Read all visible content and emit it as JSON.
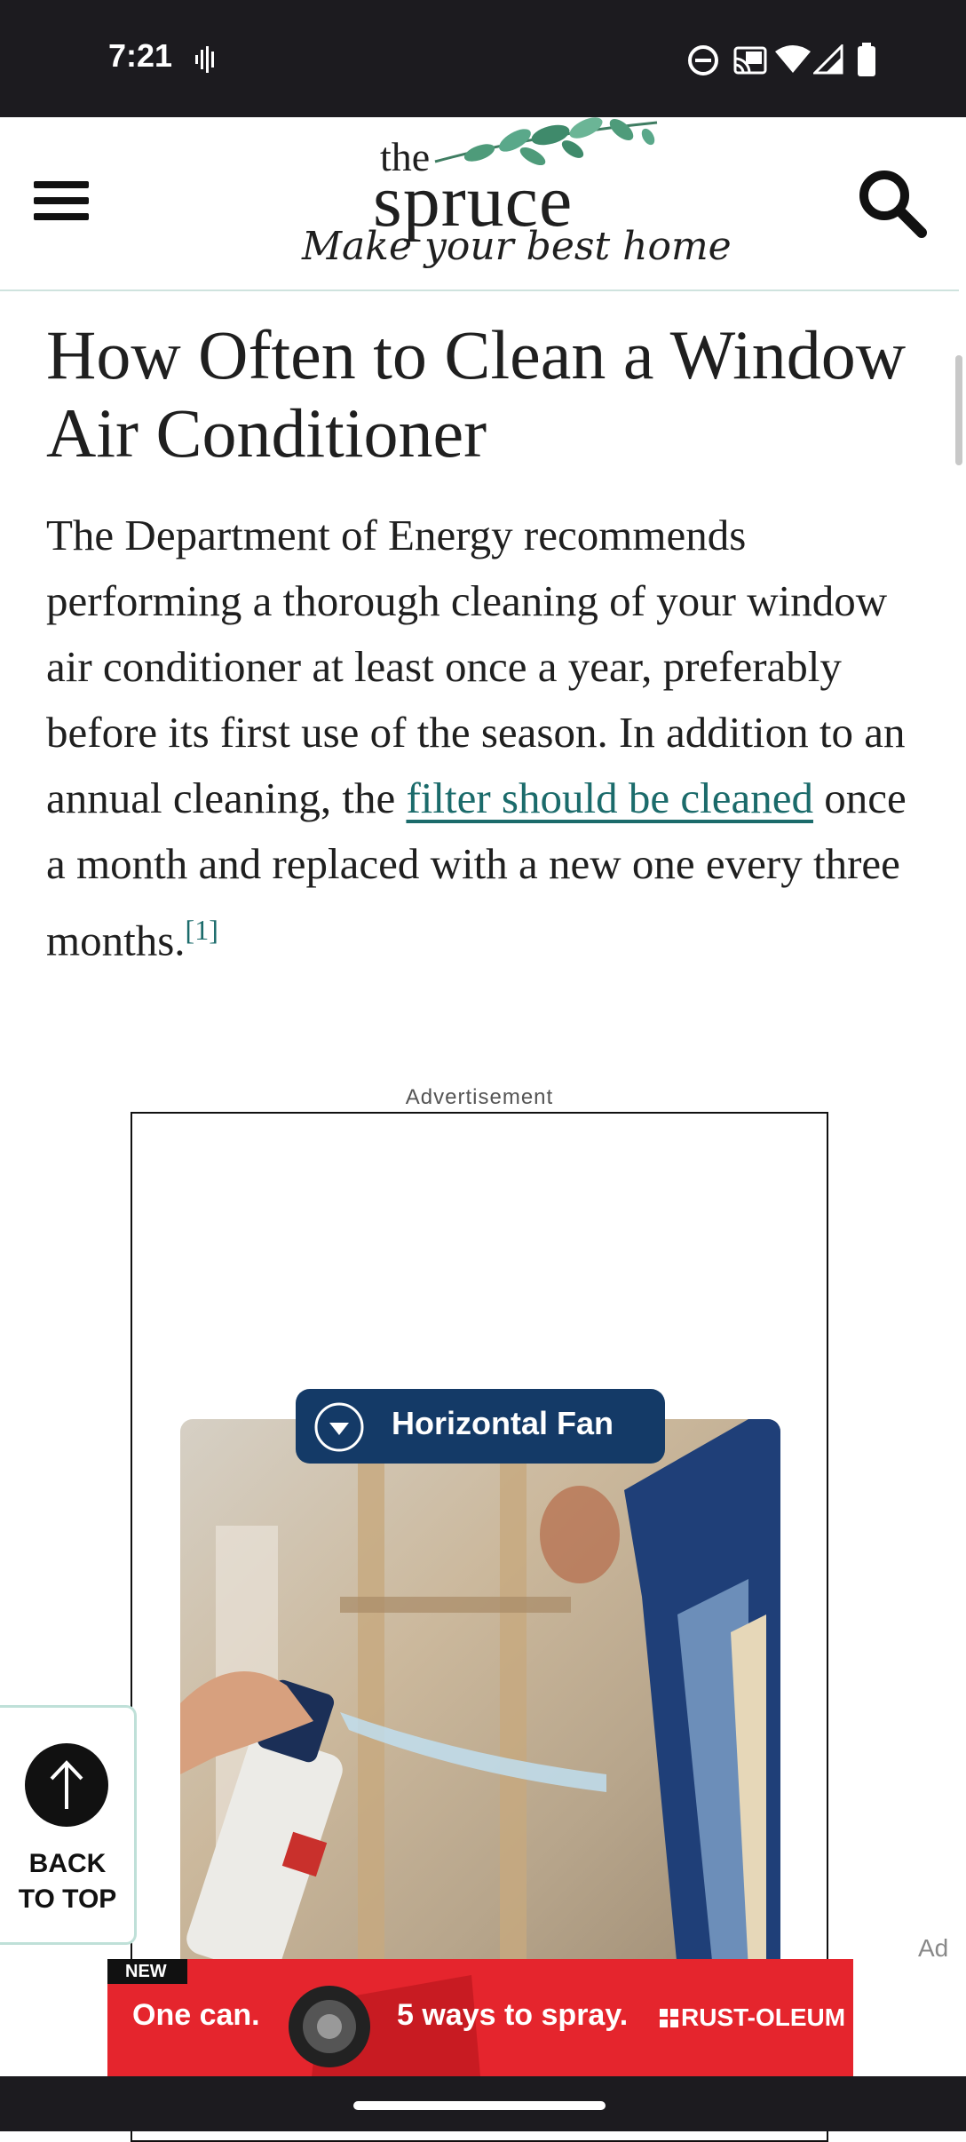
{
  "status_bar": {
    "time": "7:21"
  },
  "header": {
    "logo_the": "the",
    "logo_spruce": "spruce",
    "logo_tagline": "Make your best home"
  },
  "article": {
    "title": "How Often to Clean a Window Air Conditioner",
    "body_before_link": "The Department of Energy recommends performing a thorough cleaning of your window air conditioner at least once a year, preferably before its first use of the season. In addition to an annual cleaning, the ",
    "body_link": "filter should be cleaned",
    "body_after_link": " once a month and replaced with a new one every three months.",
    "footnote": "[1]"
  },
  "advertisement": {
    "label": "Advertisement",
    "fan_button": "Horizontal Fan",
    "side_label": "Ad"
  },
  "back_to_top": {
    "line1": "BACK",
    "line2": "TO TOP"
  },
  "banner_ad": {
    "badge": "NEW",
    "text1": "One can.",
    "text2": "5 ways to spray.",
    "brand": "RUST-OLEUM"
  },
  "colors": {
    "link": "#1b6b6b",
    "fan_pill": "#143a67",
    "banner": "#e5252d",
    "status_bar": "#1c1b1f"
  }
}
